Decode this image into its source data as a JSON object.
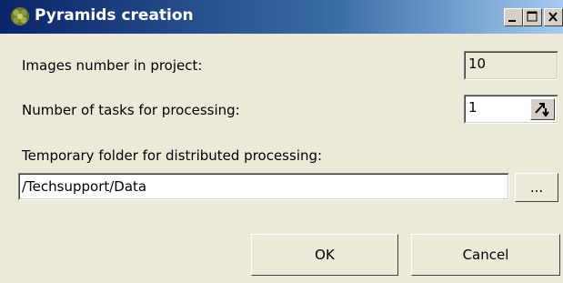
{
  "window": {
    "title": "Pyramids creation",
    "icon": "pyramid-app-icon"
  },
  "titlebar_buttons": {
    "minimize_icon": "minimize-icon",
    "maximize_icon": "maximize-icon",
    "close_icon": "close-icon"
  },
  "form": {
    "images_number_label": "Images number in project:",
    "images_number_value": "10",
    "tasks_label": "Number of tasks for processing:",
    "tasks_value": "1",
    "temp_folder_label": "Temporary folder for distributed processing:",
    "temp_folder_value": "/Techsupport/Data",
    "browse_label": "..."
  },
  "buttons": {
    "ok_label": "OK",
    "cancel_label": "Cancel"
  },
  "colors": {
    "titlebar_start": "#0a246a",
    "titlebar_end": "#a6caf0",
    "dialog_background": "#ece9d8"
  }
}
